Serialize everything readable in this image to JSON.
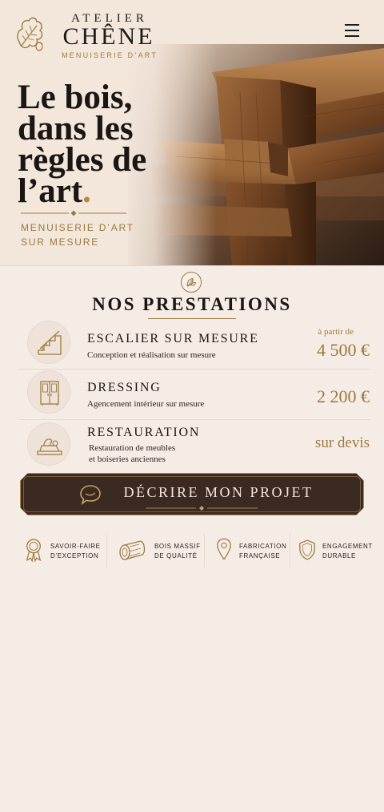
{
  "brand": {
    "top": "ATELIER",
    "main": "CHÊNE",
    "sub": "MENUISERIE D’ART"
  },
  "hero": {
    "title_line1": "Le bois,",
    "title_line2": "dans les",
    "title_line3": "règles de",
    "title_line4": "l’art",
    "title_dot": ".",
    "sub_line1": "MENUISERIE D’ART",
    "sub_line2": "SUR MESURE"
  },
  "section": {
    "title": "NOS PRESTATIONS"
  },
  "services": [
    {
      "name": "ESCALIER SUR MESURE",
      "desc_line1": "Conception et réalisation sur mesure",
      "desc_line2": "",
      "from": "à partir de",
      "price": "4 500 €",
      "icon": "staircase-icon"
    },
    {
      "name": "DRESSING",
      "desc_line1": "Agencement intérieur sur mesure",
      "desc_line2": "",
      "price": "2 200 €",
      "icon": "wardrobe-icon"
    },
    {
      "name": "RESTAURATION",
      "desc_line1": "Restauration de meubles",
      "desc_line2": "et boiseries anciennes",
      "price": "sur devis",
      "icon": "wood-plane-icon"
    }
  ],
  "cta": {
    "label": "DÉCRIRE MON PROJET",
    "icon": "speech-bubble-icon"
  },
  "features": [
    {
      "line1": "SAVOIR-FAIRE",
      "line2": "D’EXCEPTION",
      "icon": "award-ribbon-icon"
    },
    {
      "line1": "BOIS MASSIF",
      "line2": "DE QUALITÉ",
      "icon": "log-icon"
    },
    {
      "line1": "FABRICATION",
      "line2": "FRANÇAISE",
      "icon": "location-pin-icon"
    },
    {
      "line1": "ENGAGEMENT",
      "line2": "DURABLE",
      "icon": "shield-icon"
    }
  ],
  "colors": {
    "background": "#f6ece6",
    "gold": "#9b7a3e",
    "dark_button": "#3b2a21",
    "text": "#1a1613"
  }
}
